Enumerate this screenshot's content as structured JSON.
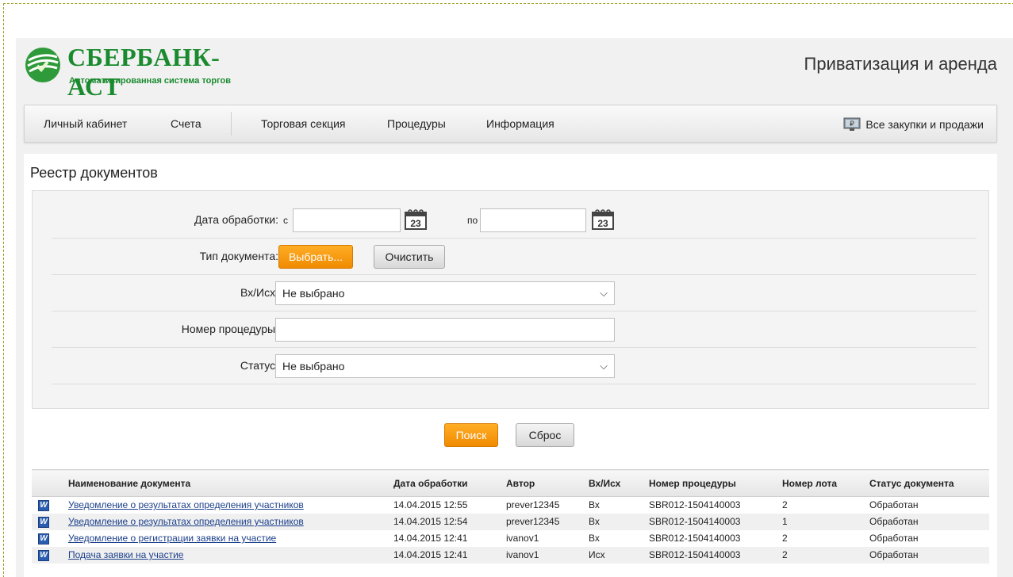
{
  "header": {
    "logo_title": "СБЕРБАНК-АСТ",
    "logo_subtitle": "Автоматизированная система торгов",
    "section_title": "Приватизация и аренда",
    "brand_color": "#1a8a2e"
  },
  "nav": {
    "items": [
      "Личный кабинет",
      "Счета",
      "Торговая секция",
      "Процедуры",
      "Информация"
    ],
    "right_label": "Все закупки и продажи"
  },
  "page": {
    "title": "Реестр документов"
  },
  "filters": {
    "date_label": "Дата обработки:",
    "date_from_prefix": "с",
    "date_to_prefix": "по",
    "date_from_value": "",
    "date_to_value": "",
    "calendar_day": "23",
    "doc_type_label": "Тип документа:",
    "choose_button": "Выбрать...",
    "clear_button": "Очистить",
    "in_out_label": "Вх/Исх:",
    "in_out_value": "Не выбрано",
    "procedure_number_label": "Номер процедуры:",
    "procedure_number_value": "",
    "status_label": "Статус:",
    "status_value": "Не выбрано"
  },
  "actions": {
    "search_button": "Поиск",
    "reset_button": "Сброс"
  },
  "table": {
    "columns": [
      "Наименование документа",
      "Дата обработки",
      "Автор",
      "Вх/Исх",
      "Номер процедуры",
      "Номер лота",
      "Статус документа"
    ],
    "rows": [
      [
        "Уведомление о результатах определения участников",
        "14.04.2015 12:55",
        "prever12345",
        "Вх",
        "SBR012-1504140003",
        "2",
        "Обработан"
      ],
      [
        "Уведомление о результатах определения участников",
        "14.04.2015 12:54",
        "prever12345",
        "Вх",
        "SBR012-1504140003",
        "1",
        "Обработан"
      ],
      [
        "Уведомление о регистрации заявки на участие",
        "14.04.2015 12:41",
        "ivanov1",
        "Вх",
        "SBR012-1504140003",
        "2",
        "Обработан"
      ],
      [
        "Подача заявки на участие",
        "14.04.2015 12:41",
        "ivanov1",
        "Исх",
        "SBR012-1504140003",
        "2",
        "Обработан"
      ]
    ]
  },
  "icons": {
    "logo": "sberbank-logo-icon",
    "monitor": "ruble-monitor-icon",
    "calendar": "calendar-icon",
    "doc": "word-document-icon",
    "dropdown": "chevron-down-icon"
  },
  "colors": {
    "accent_orange": "#f08a00",
    "link_blue": "#1b3f8b"
  }
}
